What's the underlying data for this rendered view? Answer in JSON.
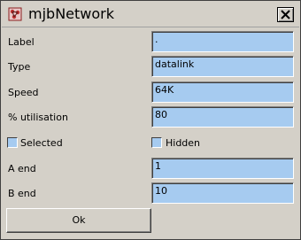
{
  "window": {
    "title": "mjbNetwork",
    "app_icon": "network-app-icon",
    "close_icon": "close-icon"
  },
  "fields": [
    {
      "label": "Label",
      "value": "."
    },
    {
      "label": "Type",
      "value": "datalink"
    },
    {
      "label": "Speed",
      "value": "64K"
    },
    {
      "label": "% utilisation",
      "value": "80"
    }
  ],
  "checkboxes": {
    "selected": {
      "label": "Selected",
      "checked": false
    },
    "hidden": {
      "label": "Hidden",
      "checked": false
    }
  },
  "ends": [
    {
      "label": "A end",
      "value": "1"
    },
    {
      "label": "B end",
      "value": "10"
    }
  ],
  "ok_label": "Ok",
  "colors": {
    "field_bg": "#a6cbf0",
    "panel_bg": "#d4d0c8"
  }
}
